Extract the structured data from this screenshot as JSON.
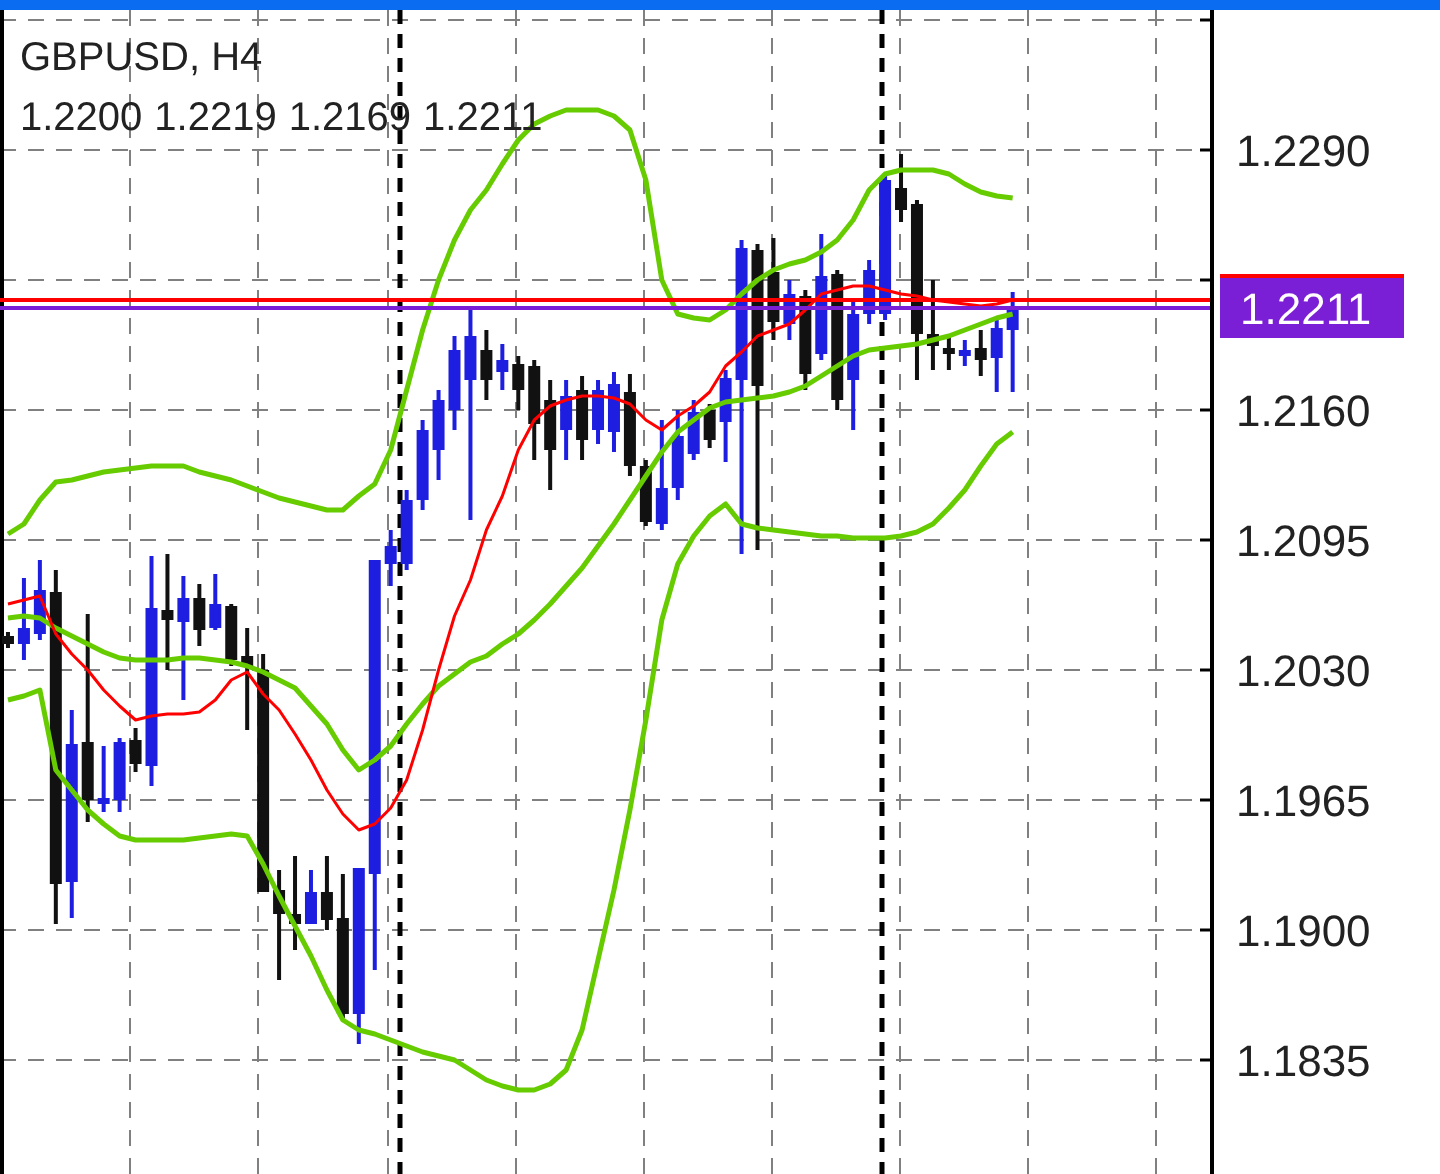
{
  "chart": {
    "symbol": "GBPUSD, H4",
    "ohlc": [
      "1.2200",
      "1.2219",
      "1.2169",
      "1.2211"
    ],
    "chart_data": {
      "type": "candlestick",
      "grid": true,
      "ylim": [
        1.1778,
        1.236
      ],
      "categories": [
        null,
        null,
        null,
        null,
        null,
        null,
        null,
        null,
        null,
        null,
        null,
        null,
        null,
        null,
        null,
        null,
        null,
        null,
        null,
        null,
        null,
        null,
        null,
        null,
        null,
        null,
        null,
        null,
        null,
        null,
        null,
        null,
        null,
        null,
        null,
        null,
        null,
        null,
        null,
        null,
        null,
        null,
        null,
        null,
        null,
        null,
        null,
        null,
        null,
        null,
        null,
        null,
        null,
        null,
        null,
        null,
        null,
        null,
        null,
        null,
        null,
        null,
        null,
        null,
        null,
        null,
        null,
        null,
        null,
        null,
        null,
        null,
        null,
        null,
        null,
        null
      ],
      "yticks": [
        {
          "value": 1.229,
          "label": "1.2290"
        },
        {
          "value": 1.216,
          "label": "1.2160"
        },
        {
          "value": 1.2095,
          "label": "1.2095"
        },
        {
          "value": 1.203,
          "label": "1.2030"
        },
        {
          "value": 1.1965,
          "label": "1.1965"
        },
        {
          "value": 1.19,
          "label": "1.1900"
        },
        {
          "value": 1.1835,
          "label": "1.1835"
        }
      ],
      "ohlc": [
        [
          1.2047,
          1.2049,
          1.2041,
          1.2043
        ],
        [
          1.2043,
          1.2076,
          1.2035,
          1.2051
        ],
        [
          1.2048,
          1.2085,
          1.2045,
          1.207
        ],
        [
          1.2069,
          1.208,
          1.1903,
          1.1923
        ],
        [
          1.1924,
          1.201,
          1.1906,
          1.1993
        ],
        [
          1.1994,
          1.2058,
          1.1954,
          1.1965
        ],
        [
          1.1963,
          1.1992,
          1.1959,
          1.1966
        ],
        [
          1.1965,
          1.1996,
          1.1959,
          1.1994
        ],
        [
          1.1995,
          1.2001,
          1.1979,
          1.1983
        ],
        [
          1.1982,
          1.2087,
          1.1972,
          1.2061
        ],
        [
          1.206,
          1.2088,
          1.203,
          1.2055
        ],
        [
          1.2054,
          1.2077,
          1.2015,
          1.2066
        ],
        [
          1.2066,
          1.2073,
          1.2042,
          1.205
        ],
        [
          1.2051,
          1.2078,
          1.205,
          1.2063
        ],
        [
          1.2062,
          1.2063,
          1.2032,
          1.2035
        ],
        [
          1.2037,
          1.2051,
          1.2,
          1.2032
        ],
        [
          1.203,
          1.2038,
          1.1919,
          1.1919
        ],
        [
          1.192,
          1.193,
          1.1875,
          1.1908
        ],
        [
          1.1908,
          1.1937,
          1.189,
          1.1903
        ],
        [
          1.1903,
          1.193,
          1.1903,
          1.1919
        ],
        [
          1.1919,
          1.1937,
          1.19,
          1.1905
        ],
        [
          1.1906,
          1.1928,
          1.1856,
          1.1858
        ],
        [
          1.1858,
          1.1931,
          1.1843,
          1.1931
        ],
        [
          1.1928,
          1.2085,
          1.188,
          1.2085
        ],
        [
          1.2083,
          1.21,
          1.2072,
          1.2092
        ],
        [
          1.2083,
          1.212,
          1.208,
          1.2115
        ],
        [
          1.2115,
          1.2155,
          1.211,
          1.215
        ],
        [
          1.214,
          1.217,
          1.2125,
          1.2165
        ],
        [
          1.216,
          1.2197,
          1.215,
          1.219
        ],
        [
          1.2175,
          1.221,
          1.2105,
          1.2197
        ],
        [
          1.219,
          1.22,
          1.2165,
          1.2175
        ],
        [
          1.2179,
          1.2193,
          1.217,
          1.2185
        ],
        [
          1.2183,
          1.2187,
          1.216,
          1.217
        ],
        [
          1.2182,
          1.2185,
          1.2135,
          1.2153
        ],
        [
          1.2165,
          1.2175,
          1.212,
          1.214
        ],
        [
          1.215,
          1.2175,
          1.2135,
          1.2167
        ],
        [
          1.217,
          1.2177,
          1.2135,
          1.2145
        ],
        [
          1.215,
          1.2175,
          1.2143,
          1.217
        ],
        [
          1.2149,
          1.2179,
          1.2139,
          1.2173
        ],
        [
          1.2169,
          1.2178,
          1.2127,
          1.2132
        ],
        [
          1.2132,
          1.2135,
          1.2102,
          1.2104
        ],
        [
          1.2103,
          1.2155,
          1.21,
          1.2121
        ],
        [
          1.2121,
          1.216,
          1.2115,
          1.2147
        ],
        [
          1.2138,
          1.2165,
          1.2135,
          1.2159
        ],
        [
          1.216,
          1.2163,
          1.2141,
          1.2145
        ],
        [
          1.2154,
          1.218,
          1.2134,
          1.2176
        ],
        [
          1.2175,
          1.2245,
          1.2088,
          1.2241
        ],
        [
          1.224,
          1.2243,
          1.209,
          1.2172
        ],
        [
          1.2229,
          1.2246,
          1.2195,
          1.2204
        ],
        [
          1.2203,
          1.2225,
          1.2195,
          1.2218
        ],
        [
          1.2217,
          1.222,
          1.217,
          1.2178
        ],
        [
          1.2188,
          1.2248,
          1.2185,
          1.2227
        ],
        [
          1.2228,
          1.223,
          1.216,
          1.2165
        ],
        [
          1.2175,
          1.2215,
          1.215,
          1.2208
        ],
        [
          1.2208,
          1.2235,
          1.2203,
          1.223
        ],
        [
          1.2208,
          1.2277,
          1.2205,
          1.2275
        ],
        [
          1.2271,
          1.2288,
          1.2254,
          1.226
        ],
        [
          1.2263,
          1.2265,
          1.2175,
          1.2198
        ],
        [
          1.2198,
          1.2225,
          1.218,
          1.2192
        ],
        [
          1.2191,
          1.2197,
          1.218,
          1.2188
        ],
        [
          1.2187,
          1.2195,
          1.2182,
          1.219
        ],
        [
          1.2191,
          1.22,
          1.2177,
          1.2185
        ],
        [
          1.2186,
          1.2205,
          1.2169,
          1.2201
        ],
        [
          1.22,
          1.2219,
          1.2169,
          1.2211
        ],
        null,
        null,
        null,
        null,
        null,
        null,
        null,
        null,
        null,
        null,
        null,
        null
      ],
      "series": [
        {
          "type": "line",
          "color": "#66cc00",
          "values": [
            1.2098,
            1.2103,
            1.2115,
            1.2124,
            1.2125,
            1.2127,
            1.2129,
            1.213,
            1.2131,
            1.2132,
            1.2132,
            1.2132,
            1.2129,
            1.2127,
            1.2125,
            1.2122,
            1.2119,
            1.2116,
            1.2114,
            1.2112,
            1.211,
            1.211,
            1.2117,
            1.2123,
            1.214,
            1.217,
            1.22,
            1.2225,
            1.2245,
            1.226,
            1.227,
            1.2283,
            1.2295,
            1.2303,
            1.2307,
            1.231,
            1.231,
            1.231,
            1.2307,
            1.23,
            1.2275,
            1.2225,
            1.2208,
            1.2206,
            1.2205,
            1.221,
            1.2218,
            1.2225,
            1.223,
            1.2233,
            1.2235,
            1.2239,
            1.2245,
            1.2255,
            1.227,
            1.2278,
            1.228,
            1.228,
            1.228,
            1.2278,
            1.2273,
            1.2269,
            1.2267,
            1.2266,
            null,
            null,
            null,
            null,
            null,
            null,
            null,
            null,
            null,
            null,
            null,
            null
          ]
        },
        {
          "type": "line",
          "color": "#66cc00",
          "values": [
            1.2056,
            1.2057,
            1.2056,
            1.2051,
            1.2047,
            1.2043,
            1.2039,
            1.2036,
            1.2035,
            1.2035,
            1.2035,
            1.2036,
            1.2036,
            1.2035,
            1.2034,
            1.2032,
            1.2029,
            1.2025,
            1.2021,
            1.2012,
            1.2003,
            1.199,
            1.198,
            1.1985,
            1.1992,
            1.2003,
            1.2013,
            1.2022,
            1.2028,
            1.2034,
            1.2037,
            1.2043,
            1.2048,
            1.2055,
            1.2063,
            1.2072,
            1.2081,
            1.2092,
            1.2103,
            1.2115,
            1.2127,
            1.2139,
            1.2149,
            1.2155,
            1.2161,
            1.2164,
            1.2165,
            1.2166,
            1.2167,
            1.2169,
            1.2172,
            1.2177,
            1.2182,
            1.2187,
            1.219,
            1.2191,
            1.2192,
            1.2193,
            1.2195,
            1.2197,
            1.22,
            1.2203,
            1.2206,
            1.2208,
            null,
            null,
            null,
            null,
            null,
            null,
            null,
            null,
            null,
            null,
            null,
            null
          ]
        },
        {
          "type": "line",
          "color": "#66cc00",
          "values": [
            1.2015,
            1.2017,
            1.202,
            1.198,
            1.197,
            1.196,
            1.1953,
            1.1947,
            1.1945,
            1.1945,
            1.1945,
            1.1945,
            1.1946,
            1.1947,
            1.1948,
            1.1947,
            1.1933,
            1.1917,
            1.1902,
            1.1887,
            1.187,
            1.1855,
            1.185,
            1.1848,
            1.1845,
            1.1842,
            1.1839,
            1.1837,
            1.1835,
            1.183,
            1.1825,
            1.1822,
            1.182,
            1.182,
            1.1823,
            1.183,
            1.185,
            1.1885,
            1.192,
            1.196,
            1.2005,
            1.2055,
            1.2083,
            1.2097,
            1.2107,
            1.2113,
            1.2103,
            1.2101,
            1.21,
            1.2099,
            1.2098,
            1.2097,
            1.2097,
            1.2096,
            1.2096,
            1.2096,
            1.2097,
            1.2099,
            1.2103,
            1.2111,
            1.212,
            1.2132,
            1.2143,
            1.2149,
            null,
            null,
            null,
            null,
            null,
            null,
            null,
            null,
            null,
            null,
            null,
            null
          ]
        },
        {
          "type": "line",
          "color": "#ff0000",
          "values": [
            1.2063,
            1.2065,
            1.2067,
            1.2048,
            1.2038,
            1.203,
            1.202,
            1.2012,
            1.2005,
            1.2007,
            1.2008,
            1.2008,
            1.2009,
            1.2015,
            1.2025,
            1.2029,
            1.2018,
            1.201,
            1.1998,
            1.1985,
            1.197,
            1.1958,
            1.195,
            1.1953,
            1.1961,
            1.1975,
            1.2,
            1.203,
            1.2057,
            1.2075,
            1.21,
            1.2117,
            1.214,
            1.2155,
            1.2162,
            1.2165,
            1.2167,
            1.2167,
            1.2166,
            1.2163,
            1.2155,
            1.215,
            1.2157,
            1.2162,
            1.2169,
            1.2182,
            1.2189,
            1.2197,
            1.22,
            1.2203,
            1.221,
            1.2218,
            1.222,
            1.2222,
            1.2222,
            1.222,
            1.2218,
            1.2217,
            1.2215,
            1.2214,
            1.2213,
            1.2212,
            1.2213,
            1.2215,
            null,
            null,
            null,
            null,
            null,
            null,
            null,
            null,
            null,
            null,
            null,
            null
          ]
        }
      ],
      "ref_lines": [
        {
          "axis": "y",
          "value": 1.2215,
          "color": "#ff0000"
        },
        {
          "axis": "y",
          "value": 1.2211,
          "color": "#7b1fd6",
          "label": "1.2211"
        }
      ]
    }
  }
}
